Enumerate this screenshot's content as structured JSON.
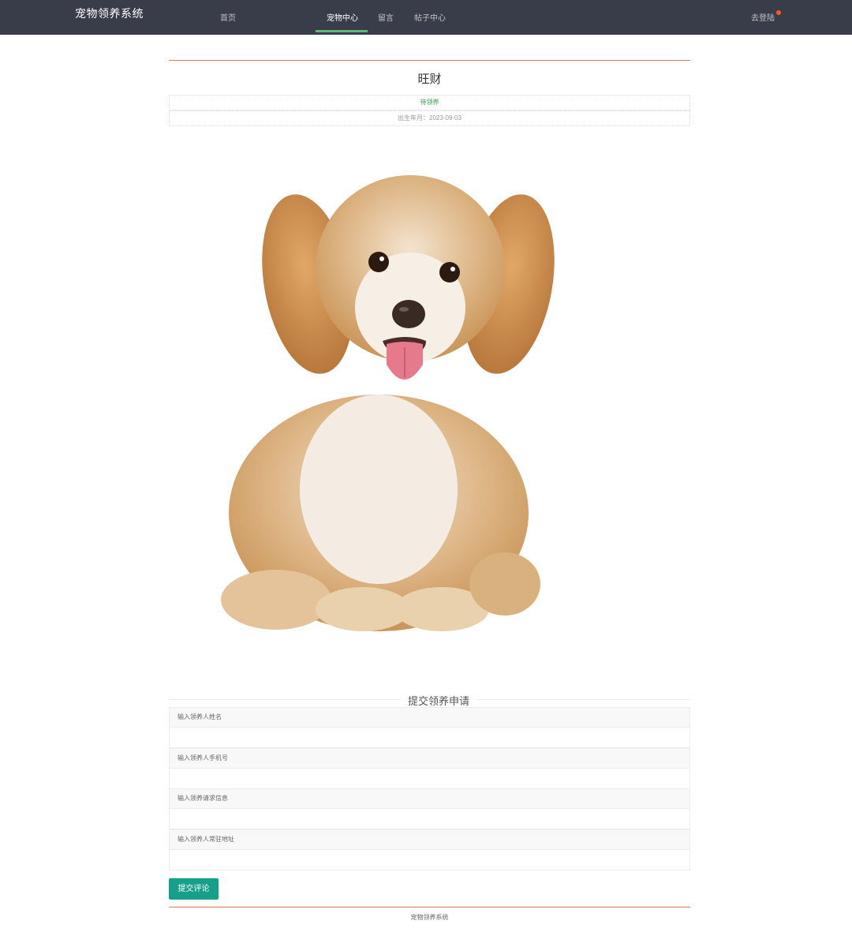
{
  "header": {
    "brand": "宠物领养系统",
    "nav": [
      "首页",
      "宠物中心",
      "留言",
      "帖子中心"
    ],
    "active_nav": "宠物中心",
    "login_label": "去登陆"
  },
  "pet": {
    "name": "旺财",
    "status": "待领养",
    "birth": "出生年月：2023-09-03",
    "photo_alt": "puppy-photo"
  },
  "form": {
    "title": "提交领养申请",
    "fields": [
      {
        "label": "输入领养人姓名",
        "value": ""
      },
      {
        "label": "输入领养人手机号",
        "value": ""
      },
      {
        "label": "输入领养请求信息",
        "value": ""
      },
      {
        "label": "输入领养人常驻地址",
        "value": ""
      }
    ],
    "submit_label": "提交评论"
  },
  "footer": {
    "text": "宠物领养系统"
  },
  "colors": {
    "nav_bg": "#393d49",
    "accent_rule": "#e07b52",
    "nav_active_underline": "#5fb878",
    "status_green": "#2e9f43",
    "button_teal": "#16a08a",
    "badge_dot": "#ff5722"
  }
}
